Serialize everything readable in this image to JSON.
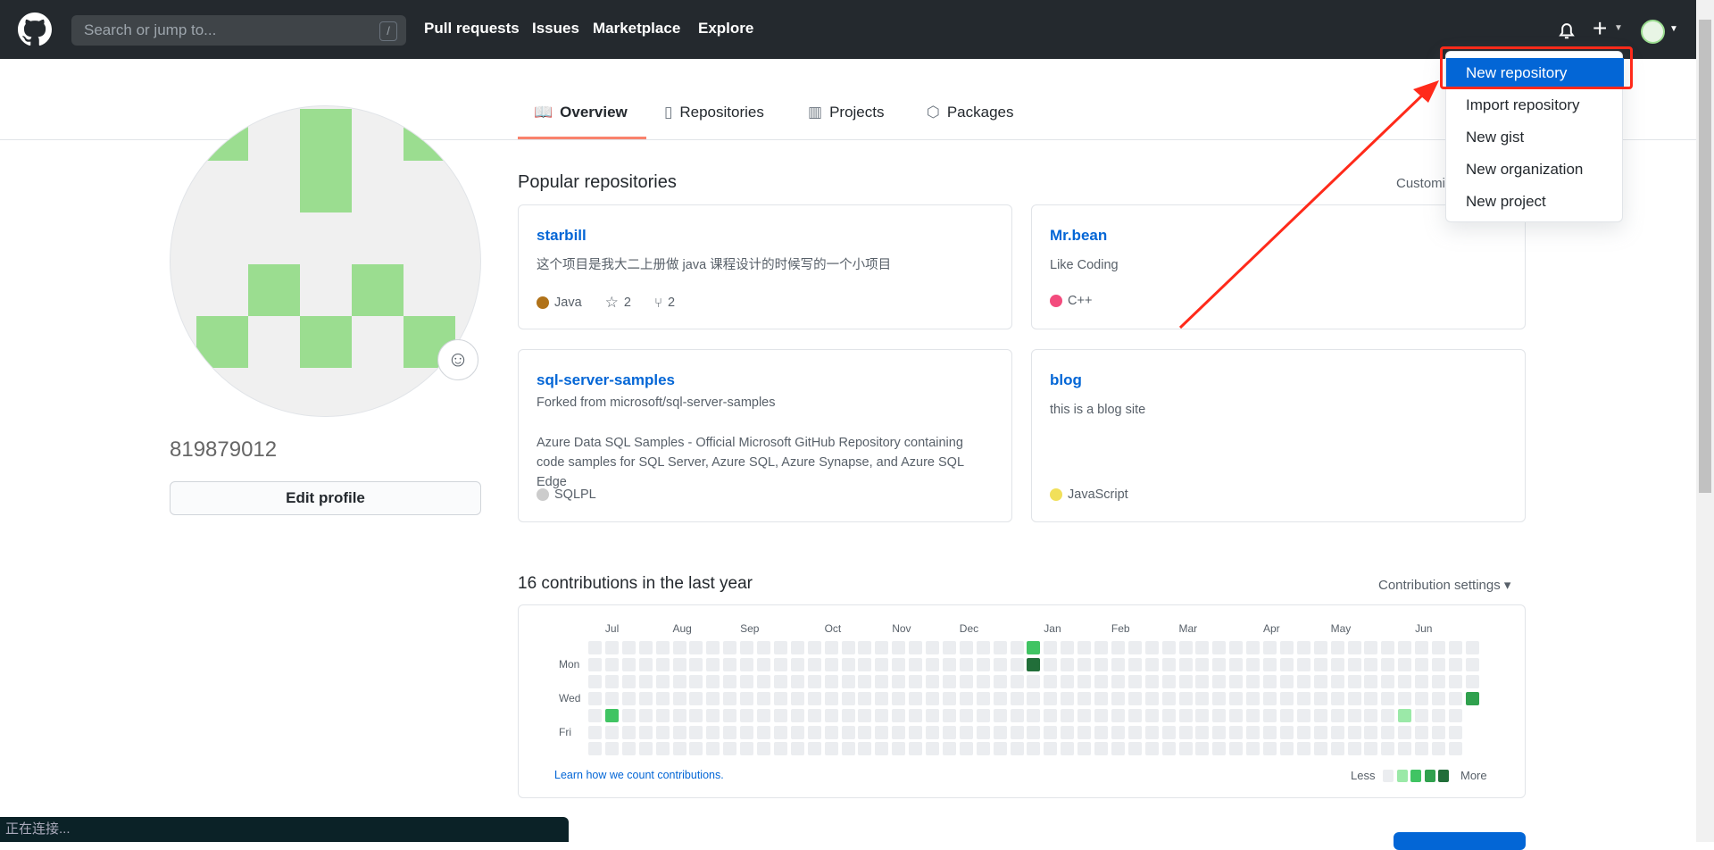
{
  "header": {
    "search_placeholder": "Search or jump to...",
    "search_shortcut": "/",
    "nav": [
      "Pull requests",
      "Issues",
      "Marketplace",
      "Explore"
    ]
  },
  "new_menu": {
    "items": [
      "New repository",
      "Import repository",
      "New gist",
      "New organization",
      "New project"
    ],
    "active": 0
  },
  "tabs": [
    {
      "label": "Overview",
      "icon": "book-icon"
    },
    {
      "label": "Repositories",
      "icon": "repo-icon"
    },
    {
      "label": "Projects",
      "icon": "project-icon"
    },
    {
      "label": "Packages",
      "icon": "package-icon"
    }
  ],
  "profile": {
    "username": "819879012",
    "edit_label": "Edit profile",
    "avatar_color": "#9bdd90"
  },
  "popular": {
    "title": "Popular repositories",
    "customize": "Customize your pins",
    "repos": [
      {
        "name": "starbill",
        "desc": "这个项目是我大二上册做 java 课程设计的时候写的一个小项目",
        "lang": "Java",
        "lang_color": "#b07219",
        "stars": "2",
        "forks": "2"
      },
      {
        "name": "Mr.bean",
        "desc": "Like Coding",
        "lang": "C++",
        "lang_color": "#f34b7d"
      },
      {
        "name": "sql-server-samples",
        "forked": "Forked from microsoft/sql-server-samples",
        "desc": "Azure Data SQL Samples - Official Microsoft GitHub Repository containing code samples for SQL Server, Azure SQL, Azure Synapse, and Azure SQL Edge",
        "lang": "SQLPL",
        "lang_color": "#cccccc"
      },
      {
        "name": "blog",
        "desc": "this is a blog site",
        "lang": "JavaScript",
        "lang_color": "#f1e05a"
      }
    ]
  },
  "contrib": {
    "title": "16 contributions in the last year",
    "settings": "Contribution settings ▾",
    "learn": "Learn how we count contributions.",
    "less": "Less",
    "more": "More",
    "colors": [
      "#ebedf0",
      "#9be9a8",
      "#40c463",
      "#30a14e",
      "#216e39"
    ],
    "weeks": 53,
    "last_week_days": 4,
    "months": [
      {
        "label": "Jul",
        "week": 1
      },
      {
        "label": "Aug",
        "week": 5
      },
      {
        "label": "Sep",
        "week": 9
      },
      {
        "label": "Oct",
        "week": 14
      },
      {
        "label": "Nov",
        "week": 18
      },
      {
        "label": "Dec",
        "week": 22
      },
      {
        "label": "Jan",
        "week": 27
      },
      {
        "label": "Feb",
        "week": 31
      },
      {
        "label": "Mar",
        "week": 35
      },
      {
        "label": "Apr",
        "week": 40
      },
      {
        "label": "May",
        "week": 44
      },
      {
        "label": "Jun",
        "week": 49
      }
    ],
    "days": [
      {
        "label": "Mon",
        "row": 1
      },
      {
        "label": "Wed",
        "row": 3
      },
      {
        "label": "Fri",
        "row": 5
      }
    ],
    "active": [
      {
        "week": 1,
        "day": 4,
        "level": 2
      },
      {
        "week": 26,
        "day": 0,
        "level": 2
      },
      {
        "week": 26,
        "day": 1,
        "level": 4
      },
      {
        "week": 48,
        "day": 4,
        "level": 1
      },
      {
        "week": 52,
        "day": 3,
        "level": 3
      }
    ]
  },
  "status_bar": "正在连接..."
}
